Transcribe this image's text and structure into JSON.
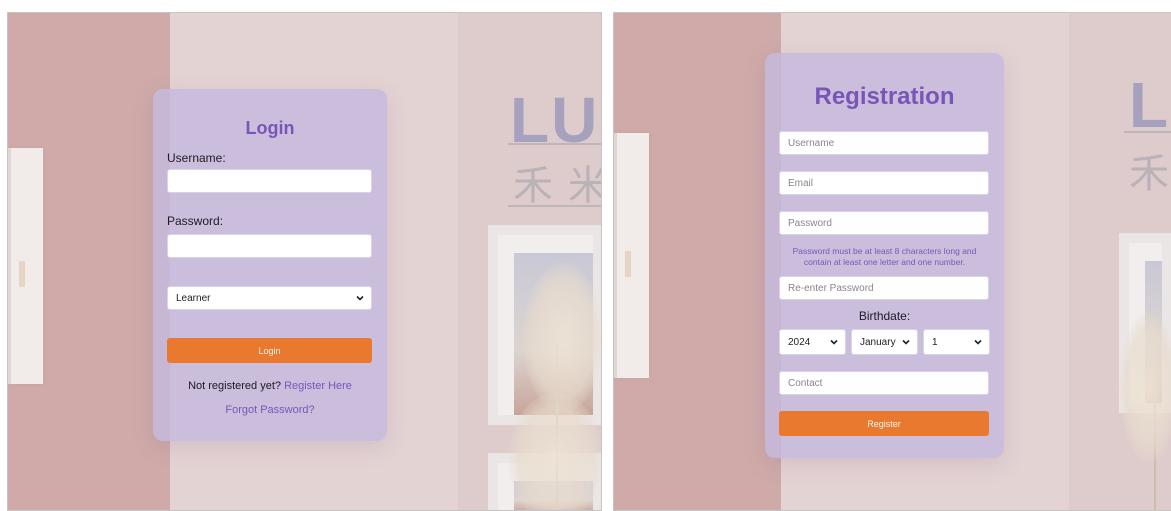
{
  "login": {
    "title": "Login",
    "username_label": "Username:",
    "username_value": "",
    "password_label": "Password:",
    "password_value": "",
    "role_select": "Learner",
    "login_button": "Login",
    "not_registered_text": "Not registered yet?",
    "register_link": "Register Here",
    "forgot_password_link": "Forgot Password?"
  },
  "registration": {
    "title": "Registration",
    "username_placeholder": "Username",
    "email_placeholder": "Email",
    "password_placeholder": "Password",
    "password_hint": "Password must be at least 8 characters long and contain at least one letter and one number.",
    "reenter_password_placeholder": "Re-enter Password",
    "birthdate_label": "Birthdate:",
    "birth_year": "2024",
    "birth_month": "January",
    "birth_day": "1",
    "contact_placeholder": "Contact",
    "register_button": "Register"
  },
  "background": {
    "poster_text": "LUN",
    "cjk_text": "禾",
    "cjk_text_2": "米"
  },
  "colors": {
    "accent_purple": "#7a55b8",
    "button_orange": "#e8792f",
    "card_lavender": "#c5bade"
  }
}
